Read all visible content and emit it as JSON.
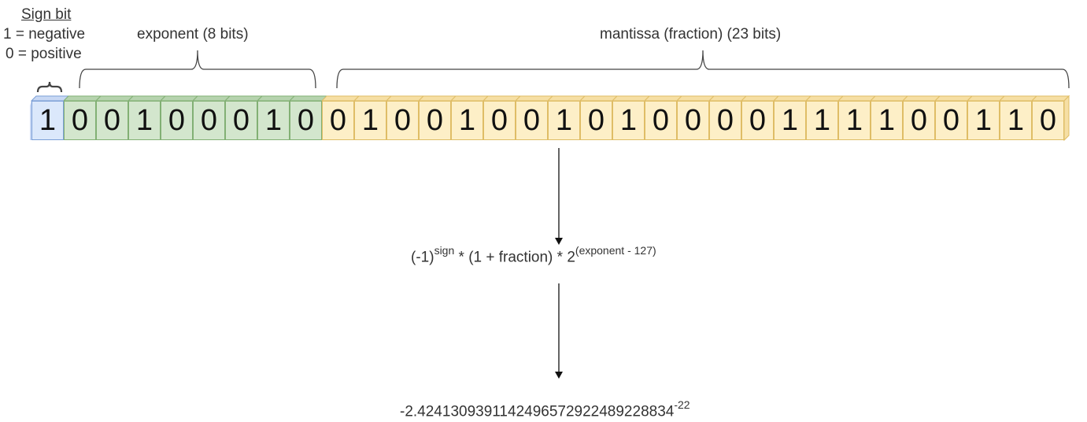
{
  "sign": {
    "title": "Sign bit",
    "line1": "1 = negative",
    "line2": "0 = positive",
    "bit": "1",
    "color_top": "#c8d8f4",
    "color_body": "#dbe8fb",
    "color_border": "#7b9fd6"
  },
  "exponent": {
    "label": "exponent (8 bits)",
    "bits": [
      "0",
      "0",
      "1",
      "0",
      "0",
      "0",
      "1",
      "0"
    ],
    "color_top": "#b6d3ae",
    "color_body": "#d3e6cd",
    "color_border": "#82b074"
  },
  "mantissa": {
    "label": "mantissa (fraction) (23 bits)",
    "bits": [
      "0",
      "1",
      "0",
      "0",
      "1",
      "0",
      "0",
      "1",
      "0",
      "1",
      "0",
      "0",
      "0",
      "0",
      "1",
      "1",
      "1",
      "1",
      "0",
      "0",
      "1",
      "1",
      "0"
    ],
    "color_top": "#f6dfa4",
    "color_body": "#fdefc7",
    "color_border": "#dfbd66"
  },
  "formula": {
    "base": "(-1)",
    "sign_sup": "sign",
    "middle": " * (1 + fraction) * 2",
    "exp_sup": "(exponent - 127)"
  },
  "result": {
    "value": "-2.4241309391142496572922489228834",
    "exp": "-22"
  }
}
